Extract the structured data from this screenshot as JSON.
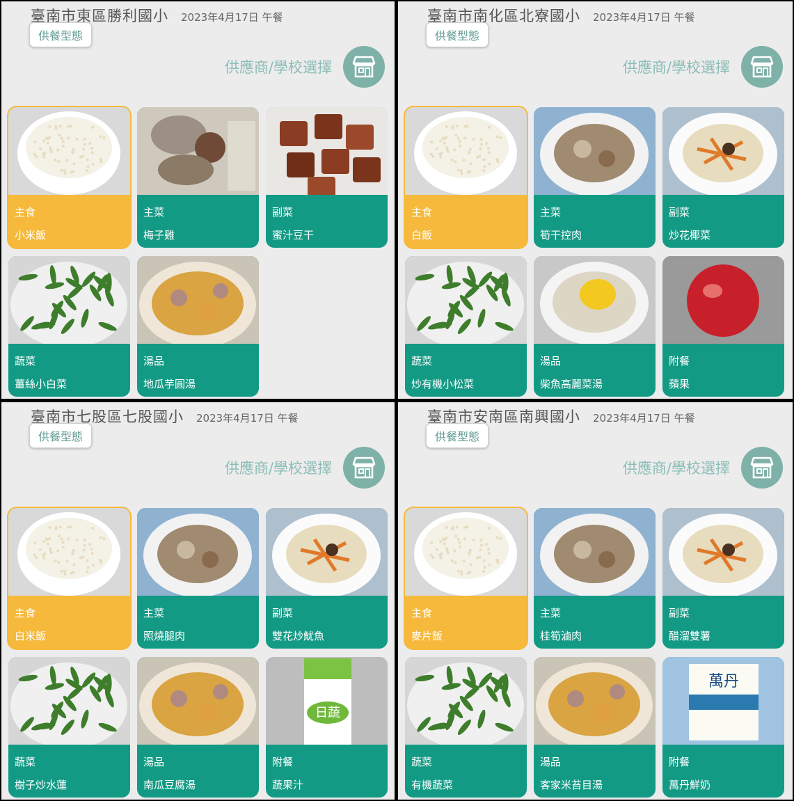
{
  "panels": [
    {
      "school": "臺南市東區勝利國小",
      "date": "2023年4月17日 午餐",
      "type_button": "供餐型態",
      "supplier_label": "供應商/學校選擇",
      "items": [
        {
          "category": "主食",
          "dish": "小米飯",
          "photo": "rice"
        },
        {
          "category": "主菜",
          "dish": "梅子雞",
          "photo": "chicken"
        },
        {
          "category": "副菜",
          "dish": "蜜汁豆干",
          "photo": "tofu"
        },
        {
          "category": "蔬菜",
          "dish": "薑絲小白菜",
          "photo": "greens"
        },
        {
          "category": "湯品",
          "dish": "地瓜芋圓湯",
          "photo": "soup"
        }
      ]
    },
    {
      "school": "臺南市南化區北寮國小",
      "date": "2023年4月17日 午餐",
      "type_button": "供餐型態",
      "supplier_label": "供應商/學校選擇",
      "items": [
        {
          "category": "主食",
          "dish": "白飯",
          "photo": "rice"
        },
        {
          "category": "主菜",
          "dish": "筍干控肉",
          "photo": "meat"
        },
        {
          "category": "副菜",
          "dish": "炒花椰菜",
          "photo": "mixed"
        },
        {
          "category": "蔬菜",
          "dish": "炒有機小松菜",
          "photo": "greens"
        },
        {
          "category": "湯品",
          "dish": "柴魚高麗菜湯",
          "photo": "corn-soup"
        },
        {
          "category": "附餐",
          "dish": "蘋果",
          "photo": "apple"
        }
      ]
    },
    {
      "school": "臺南市七股區七股國小",
      "date": "2023年4月17日 午餐",
      "type_button": "供餐型態",
      "supplier_label": "供應商/學校選擇",
      "items": [
        {
          "category": "主食",
          "dish": "白米飯",
          "photo": "rice"
        },
        {
          "category": "主菜",
          "dish": "照燒腿肉",
          "photo": "meat"
        },
        {
          "category": "副菜",
          "dish": "雙花炒魷魚",
          "photo": "mixed"
        },
        {
          "category": "蔬菜",
          "dish": "樹子炒水蓮",
          "photo": "greens"
        },
        {
          "category": "湯品",
          "dish": "南瓜豆腐湯",
          "photo": "soup"
        },
        {
          "category": "附餐",
          "dish": "蔬果汁",
          "photo": "juice"
        }
      ]
    },
    {
      "school": "臺南市安南區南興國小",
      "date": "2023年4月17日 午餐",
      "type_button": "供餐型態",
      "supplier_label": "供應商/學校選擇",
      "items": [
        {
          "category": "主食",
          "dish": "麥片飯",
          "photo": "rice"
        },
        {
          "category": "主菜",
          "dish": "桂筍滷肉",
          "photo": "meat"
        },
        {
          "category": "副菜",
          "dish": "醋溜雙薯",
          "photo": "mixed"
        },
        {
          "category": "蔬菜",
          "dish": "有機蔬菜",
          "photo": "greens"
        },
        {
          "category": "湯品",
          "dish": "客家米苔目湯",
          "photo": "soup"
        },
        {
          "category": "附餐",
          "dish": "萬丹鮮奶",
          "photo": "milk"
        }
      ]
    }
  ],
  "colors": {
    "staple_card": "#f6b93b",
    "dish_card": "#139a85",
    "shop_icon_bg": "#7eb1a8",
    "supplier_label": "#8cbdb6",
    "type_button_text": "#5f9a92"
  },
  "icons": {
    "supplier": "storefront-icon"
  }
}
